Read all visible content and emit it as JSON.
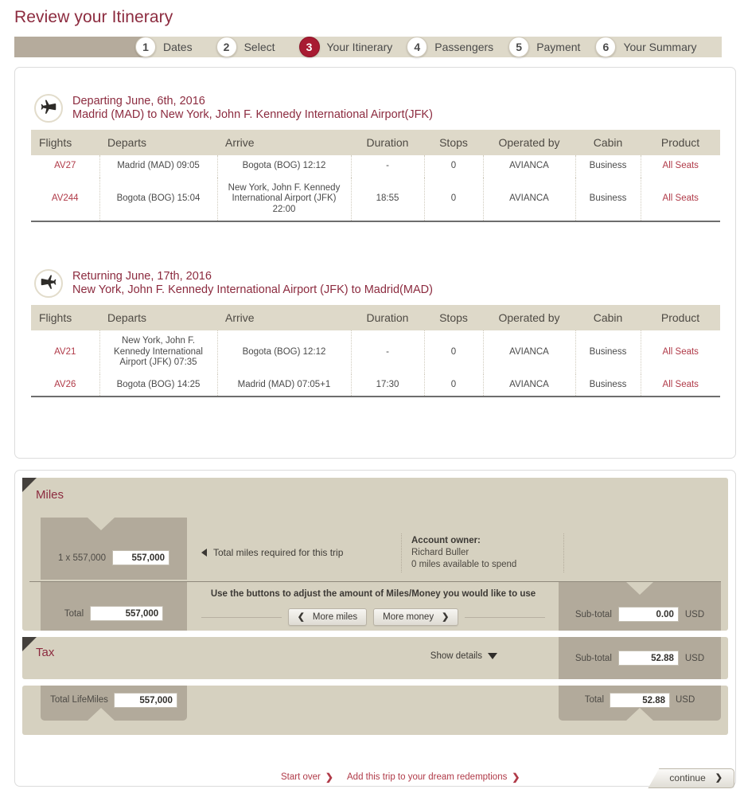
{
  "page_title": "Review your Itinerary",
  "steps": [
    {
      "num": "1",
      "label": "Dates",
      "active": false
    },
    {
      "num": "2",
      "label": "Select",
      "active": false
    },
    {
      "num": "3",
      "label": "Your Itinerary",
      "active": true
    },
    {
      "num": "4",
      "label": "Passengers",
      "active": false
    },
    {
      "num": "5",
      "label": "Payment",
      "active": false
    },
    {
      "num": "6",
      "label": "Your Summary",
      "active": false
    }
  ],
  "columns": [
    "Flights",
    "Departs",
    "Arrive",
    "Duration",
    "Stops",
    "Operated by",
    "Cabin",
    "Product"
  ],
  "outbound": {
    "icon": "plane-depart-icon",
    "line1": "Departing June, 6th, 2016",
    "line2": "Madrid (MAD) to New York, John F. Kennedy International Airport(JFK)",
    "rows": [
      {
        "flight": "AV27",
        "departs": "Madrid (MAD) 09:05",
        "arrive": "Bogota (BOG) 12:12",
        "duration": "-",
        "stops": "0",
        "operated": "AVIANCA",
        "cabin": "Business",
        "product": "All Seats"
      },
      {
        "flight": "AV244",
        "departs": "Bogota (BOG) 15:04",
        "arrive": "New York, John F. Kennedy International Airport (JFK) 22:00",
        "duration": "18:55",
        "stops": "0",
        "operated": "AVIANCA",
        "cabin": "Business",
        "product": "All Seats"
      }
    ]
  },
  "inbound": {
    "icon": "plane-return-icon",
    "line1": "Returning June, 17th, 2016",
    "line2": "New York, John F. Kennedy International Airport (JFK) to Madrid(MAD)",
    "rows": [
      {
        "flight": "AV21",
        "departs": "New York, John F. Kennedy International Airport (JFK) 07:35",
        "arrive": "Bogota (BOG) 12:12",
        "duration": "-",
        "stops": "0",
        "operated": "AVIANCA",
        "cabin": "Business",
        "product": "All Seats"
      },
      {
        "flight": "AV26",
        "departs": "Bogota (BOG) 14:25",
        "arrive": "Madrid (MAD) 07:05+1",
        "duration": "17:30",
        "stops": "0",
        "operated": "AVIANCA",
        "cabin": "Business",
        "product": "All Seats"
      }
    ]
  },
  "price": {
    "miles": {
      "section_label": "Miles",
      "multiplier_label": "1 x 557,000",
      "multiplier_value": "557,000",
      "description": "Total miles required for this trip",
      "account_owner_label": "Account owner:",
      "account_owner_name": "Richard Buller",
      "account_miles": "0  miles available to spend",
      "total_label": "Total",
      "total_value": "557,000",
      "adjust_note": "Use the buttons to adjust the amount of Miles/Money you would like to use",
      "more_miles_label": "More miles",
      "more_money_label": "More money",
      "subtotal_label": "Sub-total",
      "subtotal_value": "0.00",
      "subtotal_currency": "USD"
    },
    "tax": {
      "section_label": "Tax",
      "show_details_label": "Show details",
      "subtotal_label": "Sub-total",
      "subtotal_value": "52.88",
      "subtotal_currency": "USD"
    },
    "totals": {
      "lifemiles_label": "Total LifeMiles",
      "lifemiles_value": "557,000",
      "total_label": "Total",
      "total_value": "52.88",
      "total_currency": "USD"
    }
  },
  "actions": {
    "start_over": "Start over",
    "dream_redemptions": "Add this trip to your dream redemptions",
    "continue": "continue",
    "arrow": "❯"
  },
  "colors": {
    "brand_red": "#8c2b3f",
    "accent_red": "#b03a48",
    "active_step": "#a81b32",
    "band_dark": "#b5ab9c",
    "band_light": "#ded9c9",
    "panel_beige": "#d6d1c0",
    "box_gray": "#b2aa9b"
  }
}
